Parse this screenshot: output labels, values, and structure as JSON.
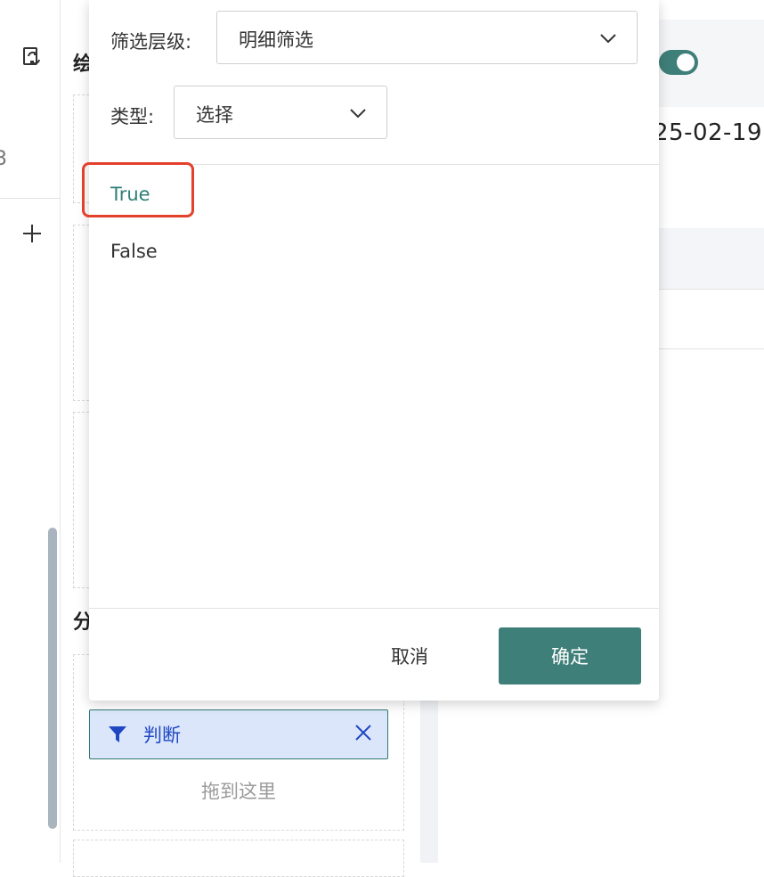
{
  "background": {
    "mid_headings": [
      "绘",
      "分"
    ],
    "right_date": "25-02-19",
    "rail_fragment": "3",
    "filter_chip": {
      "label": "判断",
      "icon": "filter-icon"
    },
    "drop_hint": "拖到这里",
    "toggle_on": true
  },
  "panel": {
    "level_label": "筛选层级:",
    "level_value": "明细筛选",
    "type_label": "类型:",
    "type_value": "选择",
    "options": [
      "True",
      "False"
    ],
    "cancel_label": "取消",
    "confirm_label": "确定"
  },
  "colors": {
    "accent": "#3f7f79",
    "highlight": "#e4412c",
    "chip_bg": "#dbe6fb",
    "chip_text": "#1f47c2"
  }
}
